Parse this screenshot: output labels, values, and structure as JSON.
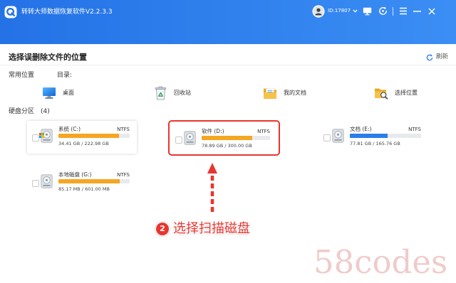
{
  "app": {
    "title": "转转大师数据恢复软件V2.2.3.3",
    "user_id": "ID:17807",
    "title_bar_icons": [
      "logo-icon",
      "avatar",
      "chevron-down-icon",
      "monitor-icon",
      "clock-refresh-icon",
      "menu-icon",
      "minimize-icon",
      "close-icon"
    ]
  },
  "main": {
    "title": "选择误删除文件的位置",
    "refresh_label": "刷新",
    "refresh_icon": "refresh-icon"
  },
  "common_locations": {
    "heading": "常用位置",
    "directory_label": "目录:",
    "items": [
      {
        "label": "桌面",
        "icon": "desktop-icon"
      },
      {
        "label": "回收站",
        "icon": "recycle-bin-icon"
      },
      {
        "label": "我的文档",
        "icon": "documents-folder-icon"
      },
      {
        "label": "选择位置",
        "icon": "folder-search-icon"
      }
    ]
  },
  "partitions": {
    "heading": "硬盘分区",
    "count": "(4)",
    "disks": [
      {
        "name": "系统 (C:)",
        "filesystem": "NTFS",
        "usage": "34.41 GB / 222.98 GB",
        "used_fraction": 0.85,
        "bar_color": "#f5a623",
        "icon": "system-drive-icon",
        "checked": false
      },
      {
        "name": "软件 (D:)",
        "filesystem": "NTFS",
        "usage": "78.89 GB / 300.00 GB",
        "used_fraction": 0.74,
        "bar_color": "#f5a623",
        "icon": "hard-drive-icon",
        "checked": false,
        "highlighted": true
      },
      {
        "name": "文档 (E:)",
        "filesystem": "NTFS",
        "usage": "77.81 GB / 165.76 GB",
        "used_fraction": 0.53,
        "bar_color": "#2b7de9",
        "icon": "hard-drive-icon",
        "checked": false
      },
      {
        "name": "本地磁盘 (G:)",
        "filesystem": "NTFS",
        "usage": "85.17 MB / 601.00 MB",
        "used_fraction": 0.86,
        "bar_color": "#f5a623",
        "icon": "hard-drive-icon",
        "checked": false
      }
    ]
  },
  "annotation": {
    "step": "2",
    "text": "选择扫描磁盘",
    "color": "#e8352f",
    "icon": "dashed-arrow-up-icon"
  },
  "watermark": "58codes",
  "theme": {
    "header_start": "#2472e6",
    "header_end": "#3b8ef4",
    "accent": "#2b7de9",
    "track": "#e8eaed"
  }
}
